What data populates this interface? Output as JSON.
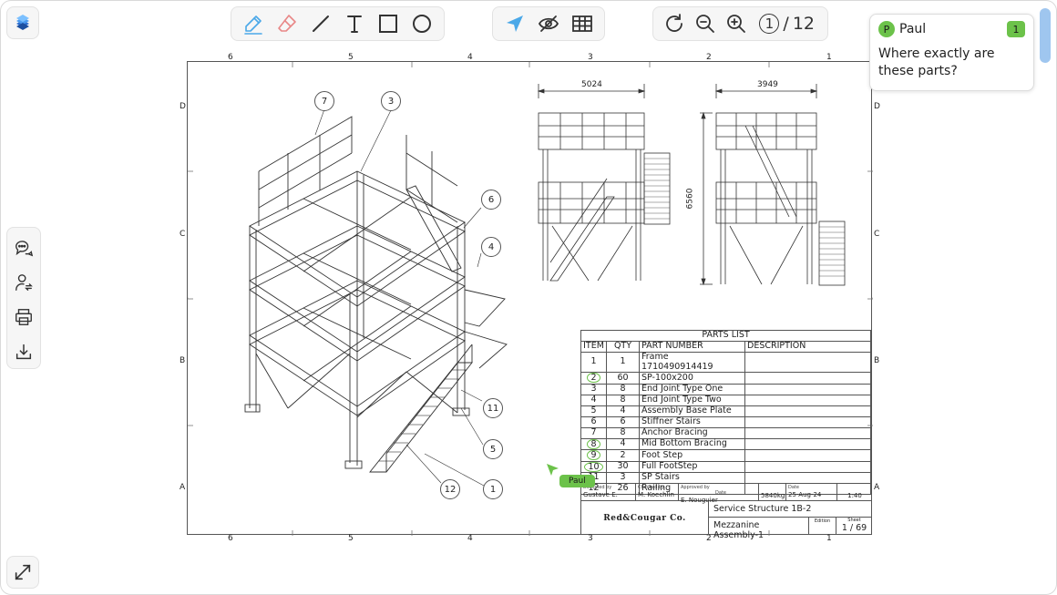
{
  "toolbar_draw": {
    "tools": [
      {
        "name": "pen-tool",
        "icon": "pen-icon"
      },
      {
        "name": "eraser-tool",
        "icon": "eraser-icon"
      },
      {
        "name": "line-tool",
        "icon": "line-icon"
      },
      {
        "name": "text-tool",
        "icon": "text-icon"
      },
      {
        "name": "rectangle-tool",
        "icon": "rectangle-icon"
      },
      {
        "name": "circle-tool",
        "icon": "circle-icon"
      }
    ],
    "active_color": "#4aa8e8",
    "eraser_color": "#e88787"
  },
  "toolbar_view": {
    "tools": [
      {
        "name": "pointer-tool",
        "icon": "pointer-icon"
      },
      {
        "name": "hide-tool",
        "icon": "eye-off-icon"
      },
      {
        "name": "grid-tool",
        "icon": "grid-icon"
      }
    ]
  },
  "toolbar_nav": {
    "page_current": "1",
    "page_separator": "/",
    "page_total": "12"
  },
  "side_panel": {
    "items": [
      {
        "name": "comments-button",
        "icon": "chat-icon"
      },
      {
        "name": "users-button",
        "icon": "user-switch-icon"
      },
      {
        "name": "print-button",
        "icon": "printer-icon"
      },
      {
        "name": "download-button",
        "icon": "download-icon"
      }
    ]
  },
  "comment": {
    "avatar_letter": "P",
    "author": "Paul",
    "count": "1",
    "text": "Where exactly are these parts?",
    "accent": "#6cc24a"
  },
  "cursor": {
    "label": "Paul"
  },
  "drawing": {
    "columns_top": [
      "6",
      "5",
      "4",
      "3",
      "2",
      "1"
    ],
    "columns_bottom": [
      "6",
      "5",
      "4",
      "3",
      "2",
      "1"
    ],
    "rows_left": [
      "D",
      "C",
      "B",
      "A"
    ],
    "rows_right": [
      "D",
      "C",
      "B",
      "A"
    ],
    "dim_width_front": "5024",
    "dim_width_side": "3949",
    "dim_height": "6560",
    "balloons": [
      "7",
      "3",
      "6",
      "4",
      "11",
      "5",
      "12",
      "1"
    ]
  },
  "parts_list": {
    "title": "PARTS LIST",
    "headers": [
      "ITEM",
      "QTY",
      "PART NUMBER",
      "DESCRIPTION"
    ],
    "rows": [
      {
        "item": "1",
        "qty": "1",
        "part": "Frame 1710490914419",
        "desc": "",
        "circled": false
      },
      {
        "item": "2",
        "qty": "60",
        "part": "SP-100x200",
        "desc": "",
        "circled": true
      },
      {
        "item": "3",
        "qty": "8",
        "part": "End Joint Type One",
        "desc": "",
        "circled": false
      },
      {
        "item": "4",
        "qty": "8",
        "part": "End Joint Type Two",
        "desc": "",
        "circled": false
      },
      {
        "item": "5",
        "qty": "4",
        "part": "Assembly Base Plate",
        "desc": "",
        "circled": false
      },
      {
        "item": "6",
        "qty": "6",
        "part": "Stiffner Stairs",
        "desc": "",
        "circled": false
      },
      {
        "item": "7",
        "qty": "8",
        "part": "Anchor Bracing",
        "desc": "",
        "circled": false
      },
      {
        "item": "8",
        "qty": "4",
        "part": "Mid Bottom Bracing",
        "desc": "",
        "circled": true
      },
      {
        "item": "9",
        "qty": "2",
        "part": "Foot Step",
        "desc": "",
        "circled": true
      },
      {
        "item": "10",
        "qty": "30",
        "part": "Full FootStep",
        "desc": "",
        "circled": true
      },
      {
        "item": "11",
        "qty": "3",
        "part": "SP Stairs",
        "desc": "",
        "circled": false
      },
      {
        "item": "12",
        "qty": "26",
        "part": "Railing",
        "desc": "",
        "circled": false
      }
    ]
  },
  "title_block": {
    "designed_by_label": "Designed by",
    "designed_by": "Gustave E.",
    "checked_by_label": "Checked by",
    "checked_by": "M. Koechlin",
    "approved_by_label": "Approved by",
    "approved_by": "E. Nouguier",
    "date_label": "Date",
    "date_label2": "Date",
    "mass": "5840kg",
    "date": "25-Aug-24",
    "scale": "1:40",
    "company": "Red&Cougar Co.",
    "title": "Service Structure 1B-2",
    "subtitle": "Mezzanine Assembly-1",
    "edition_label": "Edition",
    "sheet_label": "Sheet",
    "sheet": "1 / 69"
  }
}
